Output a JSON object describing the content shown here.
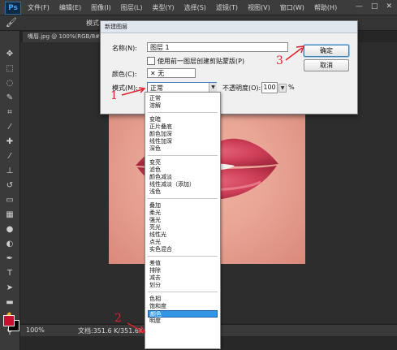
{
  "app": {
    "logo": "Ps"
  },
  "menubar": {
    "items": [
      "文件(F)",
      "编辑(E)",
      "图像(I)",
      "图层(L)",
      "类型(Y)",
      "选择(S)",
      "滤镜(T)",
      "视图(V)",
      "窗口(W)",
      "帮助(H)"
    ]
  },
  "window_controls": {
    "minimize": "—",
    "maximize": "□",
    "close": "✕"
  },
  "options_bar": {
    "mode_label": "模式:"
  },
  "document": {
    "tab_label": "嘴唇.jpg @ 100%(RGB/8#)",
    "zoom": "100%",
    "doc_size": "文档:351.6 K/351.6K"
  },
  "dialog": {
    "title": "新建图层",
    "name_label": "名称(N):",
    "name_value": "图层 1",
    "clip_label": "使用前一图层创建剪贴蒙版(P)",
    "color_label": "颜色(C):",
    "color_value": "无",
    "mode_label": "模式(M):",
    "mode_value": "正常",
    "opacity_label": "不透明度(O):",
    "opacity_value": "100",
    "opacity_unit": "%",
    "ok_label": "确定",
    "cancel_label": "取消"
  },
  "blend_modes": {
    "groups": [
      [
        "正常",
        "溶解"
      ],
      [
        "变暗",
        "正片叠底",
        "颜色加深",
        "线性加深",
        "深色"
      ],
      [
        "变亮",
        "滤色",
        "颜色减淡",
        "线性减淡（添加）",
        "浅色"
      ],
      [
        "叠加",
        "柔光",
        "强光",
        "亮光",
        "线性光",
        "点光",
        "实色混合"
      ],
      [
        "差值",
        "排除",
        "减去",
        "划分"
      ],
      [
        "色相",
        "饱和度",
        "颜色",
        "明度"
      ]
    ],
    "selected": "颜色"
  },
  "annotations": {
    "step1": "1",
    "step2": "2",
    "step3": "3",
    "color": "#e0202a"
  }
}
